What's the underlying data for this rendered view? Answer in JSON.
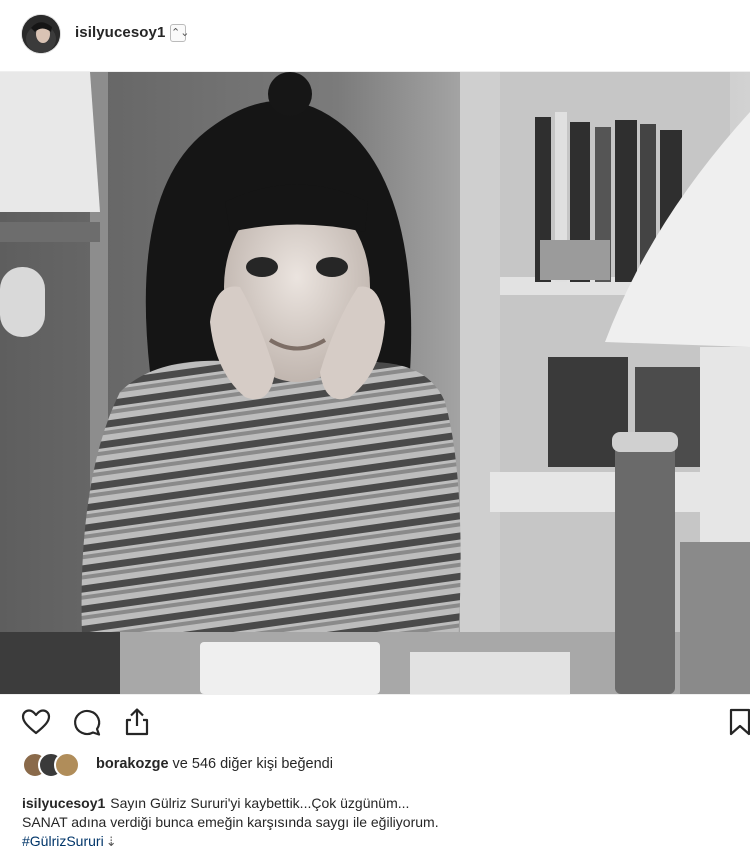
{
  "post": {
    "header": {
      "username": "isilyucesoy1",
      "verified_badge": "⌃⌄",
      "avatar_icon": "profile-avatar-icon"
    },
    "photo": {
      "description_icon": "black-and-white-portrait-photo"
    },
    "actions": {
      "like_icon": "heart-outline-icon",
      "comment_icon": "comment-bubble-icon",
      "share_icon": "share-upload-icon",
      "save_icon": "bookmark-icon"
    },
    "likes": {
      "first_liker": "borakozge",
      "rest_text": "ve 546 diğer kişi beğendi"
    },
    "caption": {
      "username": "isilyucesoy1",
      "line1": "Sayın Gülriz Sururi'yi kaybettik...Çok üzgünüm...",
      "line2": "SANAT adına verdiği bunca emeğin karşısında saygı ile eğiliyorum.",
      "hashtag": "#GülrizSururi",
      "more_arrow": "⇣"
    }
  },
  "colors": {
    "text": "#262626",
    "hashtag": "#003569",
    "border": "#efefef"
  }
}
